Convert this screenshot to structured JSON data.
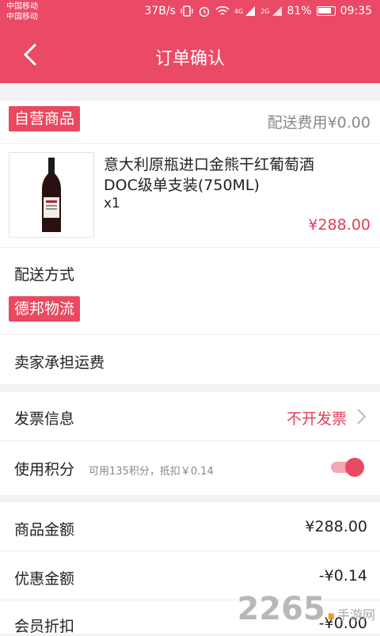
{
  "status": {
    "carrier1": "中国移动",
    "carrier2": "中国移动",
    "speed": "37B/s",
    "net1": "4G",
    "net2": "2G",
    "battery": "81%",
    "time": "09:35"
  },
  "nav": {
    "title": "订单确认"
  },
  "store": {
    "tag": "自营商品",
    "shipping_fee": "配送费用¥0.00"
  },
  "product": {
    "name_line1": "意大利原瓶进口金熊干红葡萄酒",
    "name_line2": "DOC级单支装(750ML)",
    "qty": "x1",
    "price": "¥288.00"
  },
  "delivery": {
    "label": "配送方式",
    "carrier_tag": "德邦物流",
    "note": "卖家承担运费"
  },
  "invoice": {
    "label": "发票信息",
    "value": "不开发票"
  },
  "points": {
    "label": "使用积分",
    "hint": "可用135积分，抵扣￥0.14",
    "enabled": true
  },
  "summary": {
    "goods_label": "商品金额",
    "goods_value": "¥288.00",
    "discount_label": "优惠金额",
    "discount_value": "-¥0.14",
    "member_label": "会员折扣",
    "member_value": "-¥0.00"
  },
  "watermark": {
    "number": "2265",
    "dot": ".",
    "site": "手游网"
  },
  "colors": {
    "accent": "#ea4a66",
    "price": "#e23c5c"
  }
}
